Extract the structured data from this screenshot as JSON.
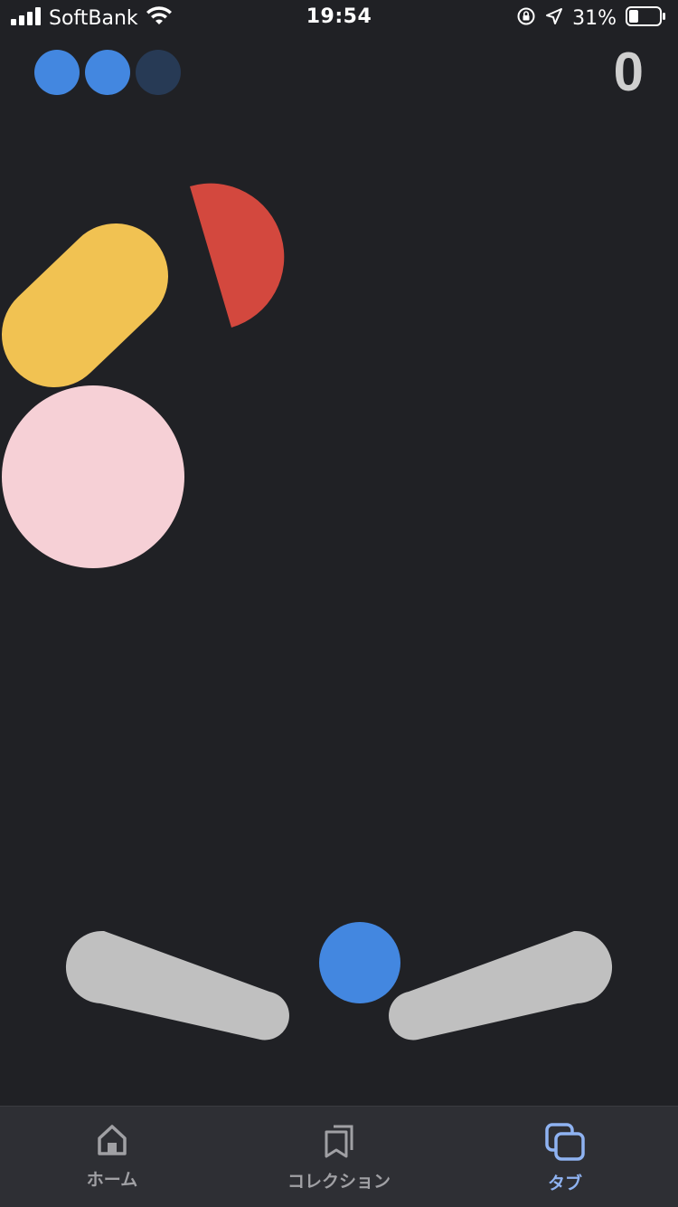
{
  "status_bar": {
    "carrier": "SoftBank",
    "time": "19:54",
    "battery_percent": "31%"
  },
  "game": {
    "lives_total": 3,
    "lives_remaining": 2,
    "score": "0",
    "colors": {
      "background": "#202125",
      "ball": "#4387e0",
      "life_active": "#4387e0",
      "life_inactive": "#273a55",
      "yellow_pill": "#f1c252",
      "red_semicircle": "#d3483e",
      "pink_bumper": "#f6d0d6",
      "flippers": "#c0c0c0"
    }
  },
  "tabbar": {
    "home_label": "ホーム",
    "collection_label": "コレクション",
    "tabs_label": "タブ",
    "active_color": "#8fb3f2",
    "inactive_color": "#a0a0a4"
  }
}
